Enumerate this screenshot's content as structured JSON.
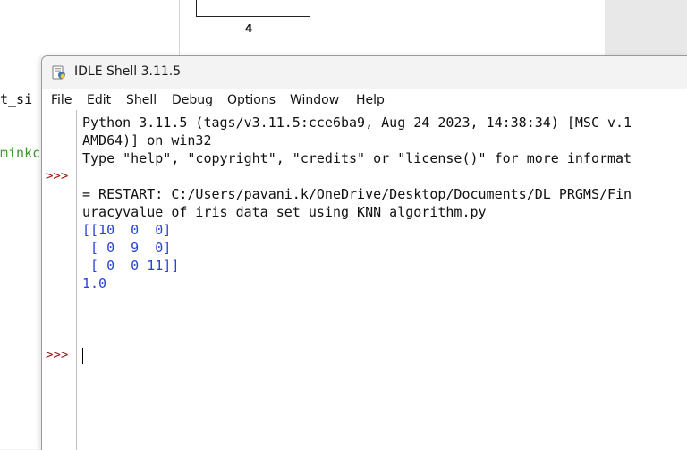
{
  "background": {
    "editor_lines": [
      {
        "text": "t_si"
      },
      {
        "text": "minkc"
      }
    ],
    "figure": {
      "tick_label": "4"
    }
  },
  "window": {
    "title": "IDLE Shell 3.11.5",
    "icon": "idle-python-icon"
  },
  "menu": {
    "items": [
      "File",
      "Edit",
      "Shell",
      "Debug",
      "Options",
      "Window",
      "Help"
    ]
  },
  "shell": {
    "banner_line1": "Python 3.11.5 (tags/v3.11.5:cce6ba9, Aug 24 2023, 14:38:34) [MSC v.1",
    "banner_line2": "AMD64)] on win32",
    "banner_line3": "Type \"help\", \"copyright\", \"credits\" or \"license()\" for more informat",
    "prompt": ">>>",
    "restart_line1": "= RESTART: C:/Users/pavani.k/OneDrive/Desktop/Documents/DL PRGMS/Fin",
    "restart_line2": "uracyvalue of iris data set using KNN algorithm.py",
    "output_lines": [
      "[[10  0  0]",
      " [ 0  9  0]",
      " [ 0  0 11]]",
      "1.0"
    ]
  },
  "colors": {
    "prompt": "#a31515",
    "output": "#2a42d8",
    "stdout_text": "#111111"
  }
}
